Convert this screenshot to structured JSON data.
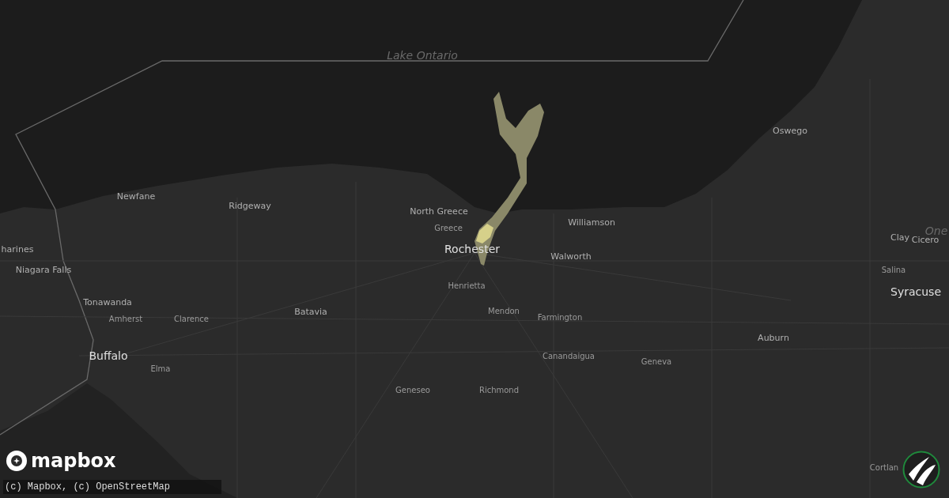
{
  "map": {
    "labels": [
      {
        "text": "Lake Ontario",
        "kind": "water"
      },
      {
        "text": "Oswego",
        "kind": "town"
      },
      {
        "text": "Newfane",
        "kind": "town"
      },
      {
        "text": "Ridgeway",
        "kind": "town"
      },
      {
        "text": "North Greece",
        "kind": "town"
      },
      {
        "text": "Williamson",
        "kind": "town"
      },
      {
        "text": "Greece",
        "kind": "small"
      },
      {
        "text": "Rochester",
        "kind": "city"
      },
      {
        "text": "Walworth",
        "kind": "town"
      },
      {
        "text": "Clay",
        "kind": "town"
      },
      {
        "text": "Cicero",
        "kind": "town"
      },
      {
        "text": "One",
        "kind": "water"
      },
      {
        "text": "harines",
        "kind": "town"
      },
      {
        "text": "Niagara Falls",
        "kind": "town"
      },
      {
        "text": "Salina",
        "kind": "small"
      },
      {
        "text": "Syracuse",
        "kind": "city"
      },
      {
        "text": "Henrietta",
        "kind": "small"
      },
      {
        "text": "Tonawanda",
        "kind": "town"
      },
      {
        "text": "Amherst",
        "kind": "small"
      },
      {
        "text": "Clarence",
        "kind": "small"
      },
      {
        "text": "Batavia",
        "kind": "town"
      },
      {
        "text": "Mendon",
        "kind": "small"
      },
      {
        "text": "Farmington",
        "kind": "small"
      },
      {
        "text": "Buffalo",
        "kind": "city"
      },
      {
        "text": "Elma",
        "kind": "small"
      },
      {
        "text": "Auburn",
        "kind": "town"
      },
      {
        "text": "Canandaigua",
        "kind": "small"
      },
      {
        "text": "Geneva",
        "kind": "small"
      },
      {
        "text": "Geneseo",
        "kind": "small"
      },
      {
        "text": "Richmond",
        "kind": "small"
      },
      {
        "text": "Cortlan",
        "kind": "small"
      }
    ]
  },
  "logo": {
    "text": "mapbox"
  },
  "attribution": "(c) Mapbox, (c) OpenStreetMap"
}
